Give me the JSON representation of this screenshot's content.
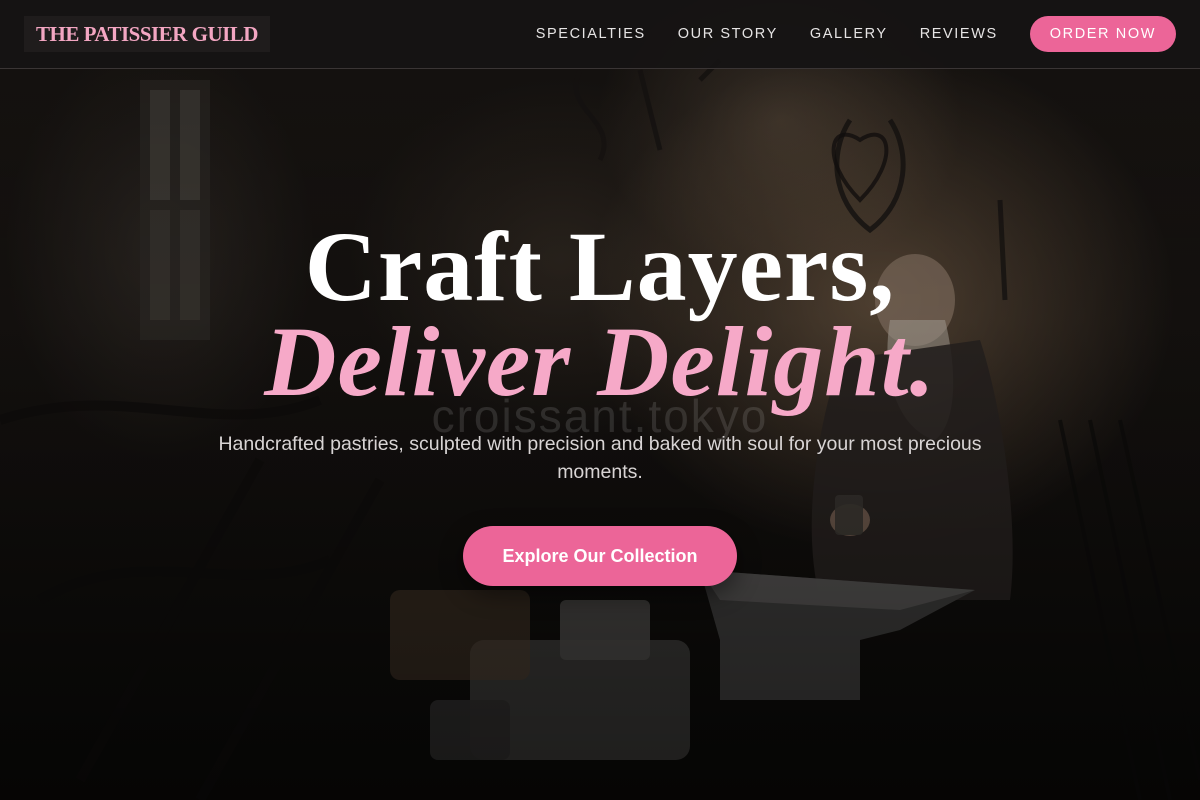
{
  "nav": {
    "logo": "THE PATISSIER GUILD",
    "links": [
      "SPECIALTIES",
      "OUR STORY",
      "GALLERY",
      "REVIEWS"
    ],
    "order_button": "ORDER NOW"
  },
  "hero": {
    "headline_line1": "Craft Layers,",
    "headline_line2": "Deliver Delight.",
    "watermark": "croissant.tokyo",
    "subtitle": "Handcrafted pastries, sculpted with precision and baked with soul for your most precious moments.",
    "cta_label": "Explore Our Collection",
    "background_image": "blacksmith-workshop-photo"
  },
  "colors": {
    "accent": "#ec6598",
    "accent_text": "#f6a9c8",
    "nav_bg": "#161414"
  }
}
